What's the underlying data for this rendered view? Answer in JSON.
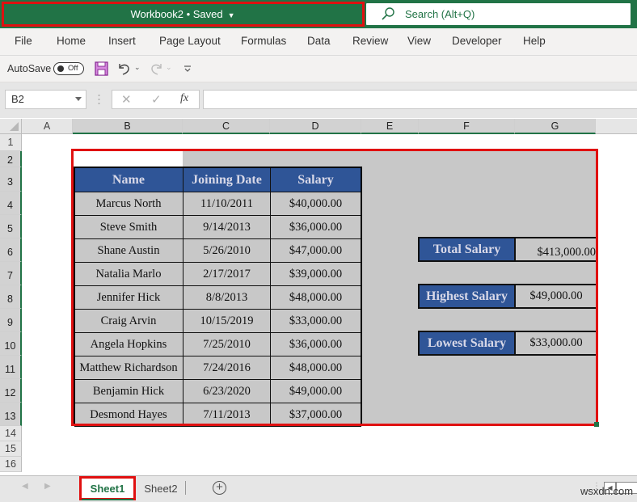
{
  "titlebar": {
    "title": "Workbook2 • Saved",
    "search_placeholder": "Search (Alt+Q)",
    "accent": "#217346"
  },
  "menu": {
    "items": [
      "File",
      "Home",
      "Insert",
      "Page Layout",
      "Formulas",
      "Data",
      "Review",
      "View",
      "Developer",
      "Help"
    ]
  },
  "qat": {
    "autosave_label": "AutoSave",
    "autosave_state": "Off"
  },
  "formula_bar": {
    "name_box": "B2",
    "cancel_icon": "✕",
    "enter_icon": "✓",
    "fx_label": "fx",
    "formula": ""
  },
  "columns": [
    "A",
    "B",
    "C",
    "D",
    "E",
    "F",
    "G"
  ],
  "rows": [
    "1",
    "2",
    "3",
    "4",
    "5",
    "6",
    "7",
    "8",
    "9",
    "10",
    "11",
    "12",
    "13",
    "14",
    "15",
    "16"
  ],
  "table": {
    "headers": [
      "Name",
      "Joining Date",
      "Salary"
    ],
    "rows": [
      [
        "Marcus North",
        "11/10/2011",
        "$40,000.00"
      ],
      [
        "Steve Smith",
        "9/14/2013",
        "$36,000.00"
      ],
      [
        "Shane Austin",
        "5/26/2010",
        "$47,000.00"
      ],
      [
        "Natalia Marlo",
        "2/17/2017",
        "$39,000.00"
      ],
      [
        "Jennifer Hick",
        "8/8/2013",
        "$48,000.00"
      ],
      [
        "Craig Arvin",
        "10/15/2019",
        "$33,000.00"
      ],
      [
        "Angela Hopkins",
        "7/25/2010",
        "$36,000.00"
      ],
      [
        "Matthew Richardson",
        "7/24/2016",
        "$48,000.00"
      ],
      [
        "Benjamin Hick",
        "6/23/2020",
        "$49,000.00"
      ],
      [
        "Desmond Hayes",
        "7/11/2013",
        "$37,000.00"
      ]
    ],
    "header_color": "#2f5597"
  },
  "summary": [
    {
      "label": "Total Salary",
      "value": "$413,000.00"
    },
    {
      "label": "Highest Salary",
      "value": "$49,000.00"
    },
    {
      "label": "Lowest Salary",
      "value": "$33,000.00"
    }
  ],
  "sheets": {
    "tabs": [
      "Sheet1",
      "Sheet2"
    ],
    "active": "Sheet1"
  },
  "watermark": "wsxdn.com",
  "highlight_color": "#e01010"
}
